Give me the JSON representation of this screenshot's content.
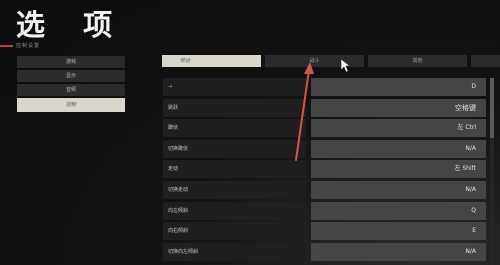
{
  "page": {
    "title": "选 项",
    "subtitle": "控制设置"
  },
  "left_menu": {
    "items": [
      {
        "label": "游戏"
      },
      {
        "label": "显示"
      },
      {
        "label": "音频"
      },
      {
        "label": "控制"
      }
    ],
    "selected_index": 3
  },
  "tabs": [
    {
      "label": "移动",
      "active": true
    },
    {
      "label": "战斗",
      "active": false
    },
    {
      "label": "其他",
      "active": false
    },
    {
      "label": "",
      "active": false
    }
  ],
  "bindings": [
    {
      "action": "→",
      "key": "D"
    },
    {
      "action": "跳跃",
      "key": "空格键"
    },
    {
      "action": "蹲伏",
      "key": "左 Ctrl"
    },
    {
      "action": "切换蹲伏",
      "key": "N/A"
    },
    {
      "action": "走动",
      "key": "左 Shift"
    },
    {
      "action": "切换走动",
      "key": "N/A"
    },
    {
      "action": "向左倾斜",
      "key": "Q"
    },
    {
      "action": "向右倾斜",
      "key": "E"
    },
    {
      "action": "切换向左倾斜",
      "key": "N/A"
    }
  ],
  "colors": {
    "accent": "#c43a3a",
    "annotation_arrow": "#d9534f",
    "selected_bg": "#d9d6cc"
  },
  "icons": {
    "cursor": "mouse-cursor-icon",
    "annotation": "red-arrow-annotation"
  }
}
